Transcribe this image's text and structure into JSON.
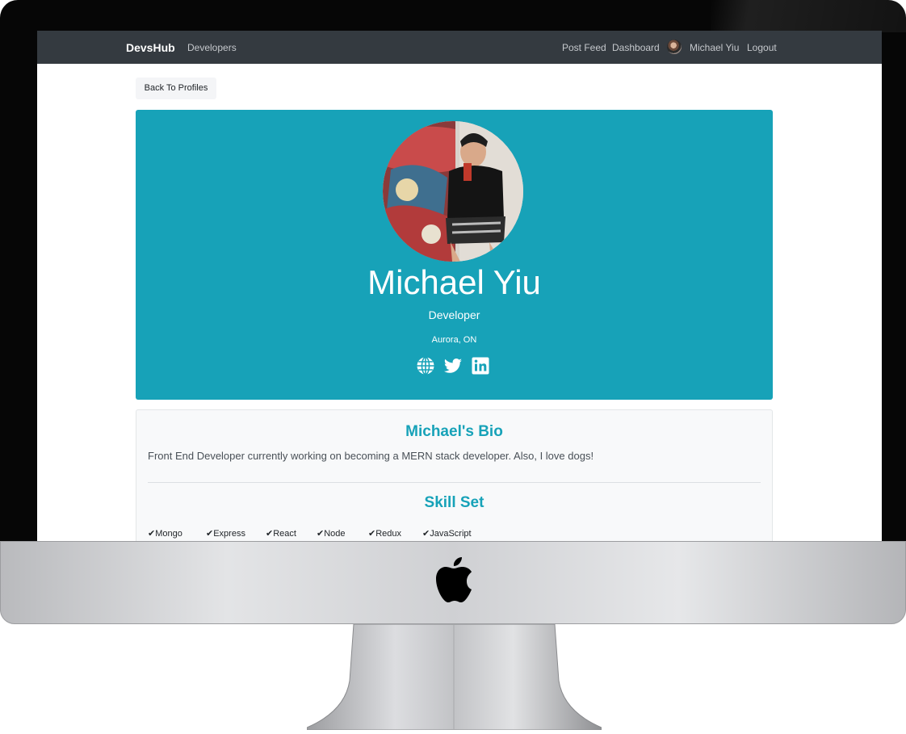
{
  "navbar": {
    "brand": "DevsHub",
    "developers_label": "Developers",
    "post_feed_label": "Post Feed",
    "dashboard_label": "Dashboard",
    "user_name": "Michael Yiu",
    "logout_label": "Logout"
  },
  "back_button_label": "Back To Profiles",
  "profile": {
    "name": "Michael Yiu",
    "title": "Developer",
    "location": "Aurora, ON",
    "social_icons": [
      "globe-icon",
      "twitter-icon",
      "linkedin-icon"
    ]
  },
  "bio": {
    "heading": "Michael's Bio",
    "text": "Front End Developer currently working on becoming a MERN stack developer. Also, I love dogs!"
  },
  "skills": {
    "heading": "Skill Set",
    "items": [
      "Mongo",
      "Express",
      "React",
      "Node",
      "Redux",
      "JavaScript"
    ]
  },
  "colors": {
    "navbar": "#343a40",
    "accent": "#17a2b8",
    "card_bg": "#f8f9fa"
  }
}
